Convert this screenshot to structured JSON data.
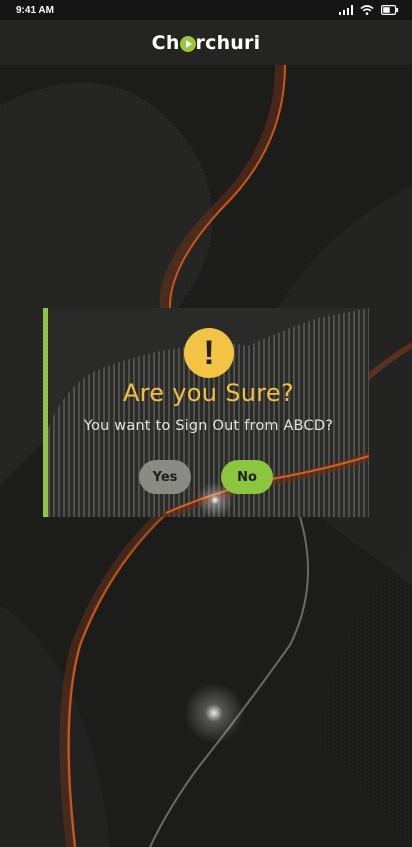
{
  "status_bar": {
    "time": "9:41 AM",
    "icons": [
      "signal-icon",
      "wifi-icon",
      "battery-icon"
    ]
  },
  "app_bar": {
    "logo_prefix": "Ch",
    "logo_suffix": "rchuri",
    "logo_icon": "play-icon"
  },
  "dialog": {
    "icon_glyph": "!",
    "title": "Are you Sure?",
    "message": "You want to Sign Out from ABCD?",
    "yes_label": "Yes",
    "no_label": "No"
  },
  "colors": {
    "accent": "#8dc63f",
    "title": "#f0c042",
    "warning": "#f3c343",
    "background": "#1b1b1a",
    "orange_streak": "#c8561c"
  }
}
